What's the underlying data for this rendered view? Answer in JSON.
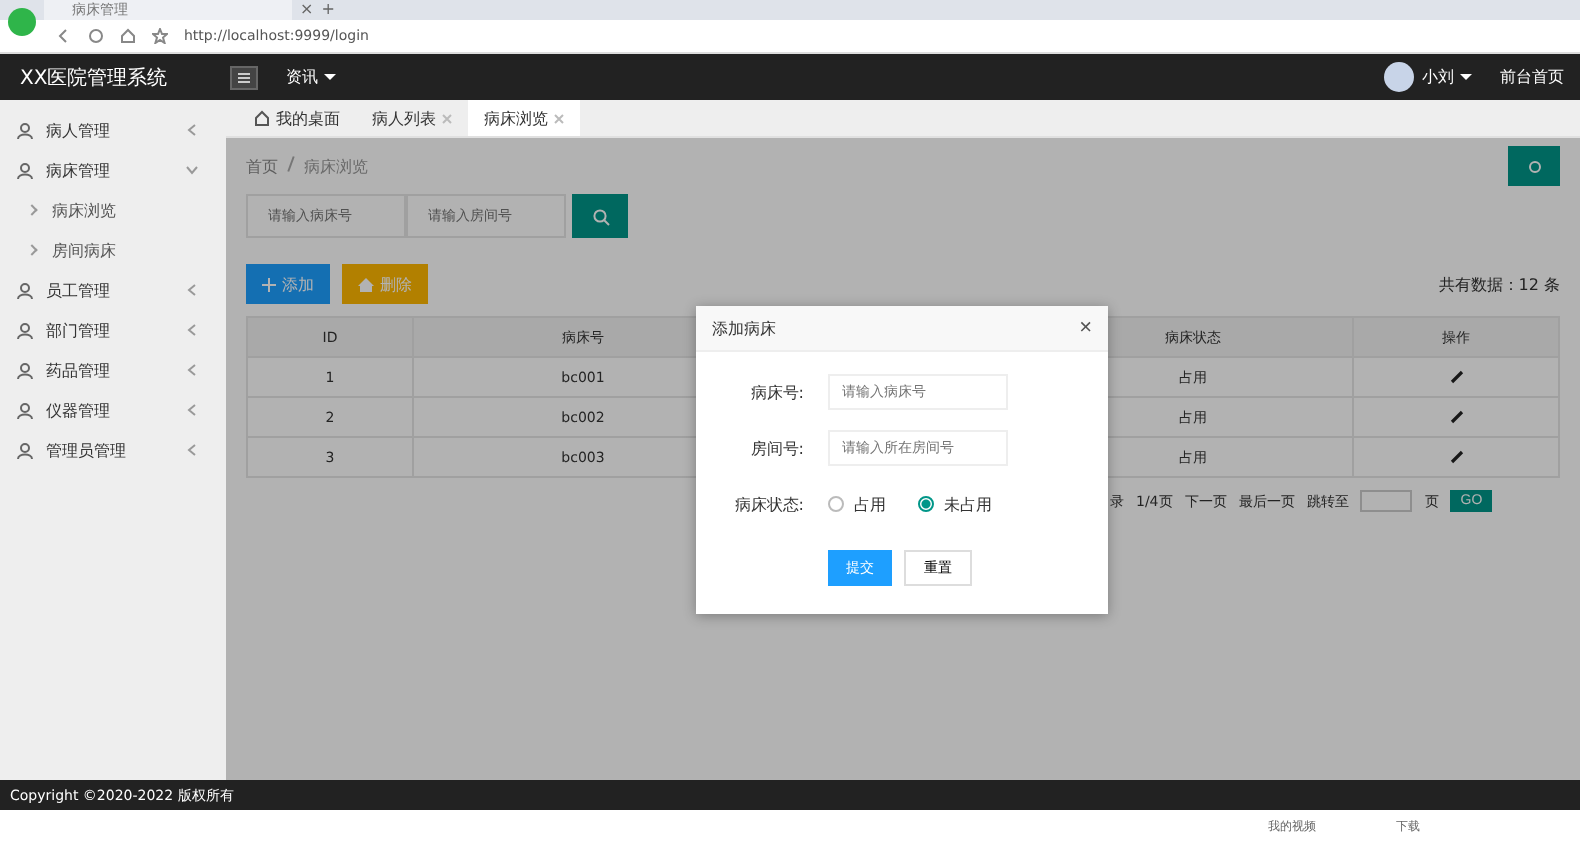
{
  "browser": {
    "tab_title": "病床管理",
    "tab_close": "×",
    "new_tab": "+",
    "url": "http://localhost:9999/login"
  },
  "header": {
    "title": "XX医院管理系统",
    "menu": "资讯",
    "user": "小刘",
    "home_link": "前台首页"
  },
  "sidebar": {
    "items": [
      {
        "label": "病人管理",
        "expanded": false
      },
      {
        "label": "病床管理",
        "expanded": true,
        "children": [
          {
            "label": "病床浏览"
          },
          {
            "label": "房间病床"
          }
        ]
      },
      {
        "label": "员工管理",
        "expanded": false
      },
      {
        "label": "部门管理",
        "expanded": false
      },
      {
        "label": "药品管理",
        "expanded": false
      },
      {
        "label": "仪器管理",
        "expanded": false
      },
      {
        "label": "管理员管理",
        "expanded": false
      }
    ]
  },
  "tabs": [
    {
      "label": "我的桌面",
      "kind": "home",
      "selected": false
    },
    {
      "label": "病人列表",
      "kind": "closable",
      "selected": false
    },
    {
      "label": "病床浏览",
      "kind": "closable",
      "selected": true
    }
  ],
  "breadcrumb": [
    "首页",
    "病床浏览"
  ],
  "search": {
    "fields": [
      {
        "placeholder": "请输入病床号"
      },
      {
        "placeholder": "请输入房间号"
      }
    ]
  },
  "toolbar": {
    "add": "添加",
    "delete": "删除",
    "total": "共有数据：12 条"
  },
  "table": {
    "columns": [
      "ID",
      "病床号",
      "病床状态",
      "操作"
    ],
    "rows": [
      [
        "1",
        "bc001",
        "占用"
      ],
      [
        "2",
        "bc002",
        "占用"
      ],
      [
        "3",
        "bc003",
        "占用"
      ]
    ]
  },
  "pagination": {
    "fragment": "录",
    "page": "1/4页",
    "next": "下一页",
    "last": "最后一页",
    "jump": "跳转至",
    "unit": "页",
    "go": "GO"
  },
  "dialog": {
    "title": "添加病床",
    "close": "×",
    "fields": [
      {
        "label": "病床号:",
        "placeholder": "请输入病床号"
      },
      {
        "label": "房间号:",
        "placeholder": "请输入所在房间号"
      }
    ],
    "status_label": "病床状态:",
    "options": [
      {
        "label": "占用",
        "selected": false
      },
      {
        "label": "未占用",
        "selected": true
      }
    ],
    "submit": "提交",
    "reset": "重置"
  },
  "footer": "Copyright ©2020-2022 版权所有",
  "status_bar": {
    "items": [
      "我的视频",
      "下载"
    ]
  }
}
